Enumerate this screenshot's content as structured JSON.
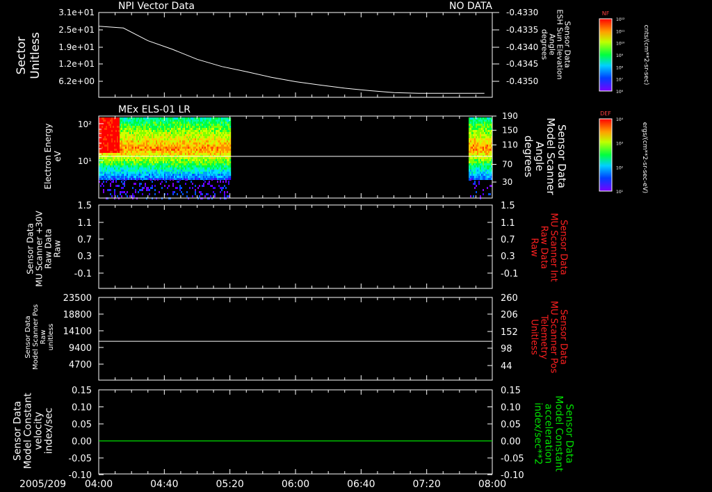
{
  "chart_data": [
    {
      "type": "line",
      "title": "NPI Vector Data",
      "status": "NO DATA",
      "ylabel": [
        "Sector",
        "Unitless"
      ],
      "yticks_left": [
        "3.1e+01",
        "2.5e+01",
        "1.9e+01",
        "1.2e+01",
        "6.2e+00"
      ],
      "ylim_left": [
        0,
        31
      ],
      "yticks_left_values": [
        31,
        25,
        19,
        12,
        6.2
      ],
      "ylabel_right": [
        "Sensor Data",
        "ESH Sun Elevation",
        "Angle",
        "degrees"
      ],
      "yticks_right": [
        "-0.4330",
        "-0.4335",
        "-0.4340",
        "-0.4345",
        "-0.4350"
      ],
      "ylim_right": [
        -0.43535,
        -0.43295
      ],
      "yticks_right_values": [
        -0.433,
        -0.4335,
        -0.434,
        -0.4345,
        -0.435
      ],
      "series": [
        {
          "axis": "right",
          "color": "#ffffff",
          "x": [
            0,
            0.25,
            0.5,
            0.75,
            1,
            1.25,
            1.5,
            1.75,
            2,
            2.25,
            2.5,
            2.75,
            3,
            3.25,
            3.5,
            3.75,
            3.92
          ],
          "y": [
            -0.4334,
            -0.43345,
            -0.43382,
            -0.43407,
            -0.43436,
            -0.43457,
            -0.43472,
            -0.43488,
            -0.43501,
            -0.43511,
            -0.4352,
            -0.43527,
            -0.43533,
            -0.43535,
            -0.43535,
            -0.43535,
            -0.43535
          ]
        }
      ],
      "colorbar": {
        "label": "NF",
        "unit": "cnts/(cm**2-sr-sec)",
        "ticks": [
          "10¹²",
          "10¹¹",
          "10¹⁰",
          "10⁹",
          "10⁸",
          "10⁷",
          "10⁶"
        ]
      }
    },
    {
      "type": "heatmap",
      "title": "MEx ELS-01 LR",
      "ylabel": [
        "Electron Energy",
        "eV"
      ],
      "yticks_left": [
        "10²",
        "10¹"
      ],
      "ylabel_right": [
        "Sensor Data",
        "Model Scanner",
        "Angle",
        "degrees"
      ],
      "yticks_right": [
        "190",
        "150",
        "110",
        "70",
        "30"
      ],
      "ylim_right": [
        0,
        190
      ],
      "data_segments": [
        [
          0,
          1.33
        ],
        [
          3.76,
          4.0
        ]
      ],
      "series": [
        {
          "axis": "right",
          "color": "#ffffff",
          "x": [
            0,
            4
          ],
          "y": [
            98,
            98
          ]
        }
      ],
      "colorbar": {
        "label": "DEF",
        "unit": "ergs/(cm**2-sr-sec-eV)",
        "ticks": [
          "10⁴",
          "10³",
          "10²",
          "10¹"
        ]
      }
    },
    {
      "type": "line",
      "ylabel": [
        "Sensor Data",
        "MU Scanner +30V",
        "Raw Data",
        "Raw"
      ],
      "yticks_left": [
        "1.5",
        "1.1",
        "0.7",
        "0.3",
        "-0.1"
      ],
      "ylim_left": [
        -0.4,
        1.5
      ],
      "ylabel_right": [
        "Sensor Data",
        "MU Scanner Int",
        "Raw Data",
        "Raw"
      ],
      "yticks_right": [
        "1.5",
        "1.1",
        "0.7",
        "0.3",
        "-0.1"
      ],
      "series": []
    },
    {
      "type": "line",
      "ylabel": [
        "Sensor Data",
        "Model Scanner Pos",
        "Raw",
        "unitless"
      ],
      "yticks_left": [
        "23500",
        "18800",
        "14100",
        "9400",
        "4700"
      ],
      "ylim_left": [
        0,
        23500
      ],
      "ylabel_right": [
        "Sensor Data",
        "MU Scanner Pos",
        "Telemetry",
        "Unitless"
      ],
      "yticks_right": [
        "260",
        "206",
        "152",
        "98",
        "44"
      ],
      "ylim_right": [
        0,
        260
      ],
      "series": [
        {
          "axis": "left",
          "color": "#ffffff",
          "x": [
            0,
            4
          ],
          "y": [
            11150,
            11150
          ]
        }
      ]
    },
    {
      "type": "line",
      "ylabel": [
        "Sensor Data",
        "Model Constant",
        "velocity",
        "index/sec"
      ],
      "yticks_left": [
        "0.15",
        "0.10",
        "0.05",
        "0.00",
        "-0.05",
        "-0.10"
      ],
      "ylim_left": [
        -0.1,
        0.15
      ],
      "ylabel_right": [
        "Sensor Data",
        "Model Constant",
        "acceleration",
        "index/sec**2"
      ],
      "yticks_right": [
        "0.15",
        "0.10",
        "0.05",
        "0.00",
        "-0.05",
        "-0.10"
      ],
      "series": [
        {
          "axis": "left",
          "color": "#00e000",
          "x": [
            0,
            4
          ],
          "y": [
            0,
            0
          ]
        }
      ]
    }
  ],
  "x_axis": {
    "date": "2005/209",
    "ticks": [
      "04:00",
      "04:40",
      "05:20",
      "06:00",
      "06:40",
      "07:20",
      "08:00"
    ],
    "range_hours": [
      4,
      8
    ]
  },
  "colors": {
    "background": "#000000",
    "axes": "#ffffff",
    "red_label": "#ff2020",
    "green_label": "#00e000"
  }
}
